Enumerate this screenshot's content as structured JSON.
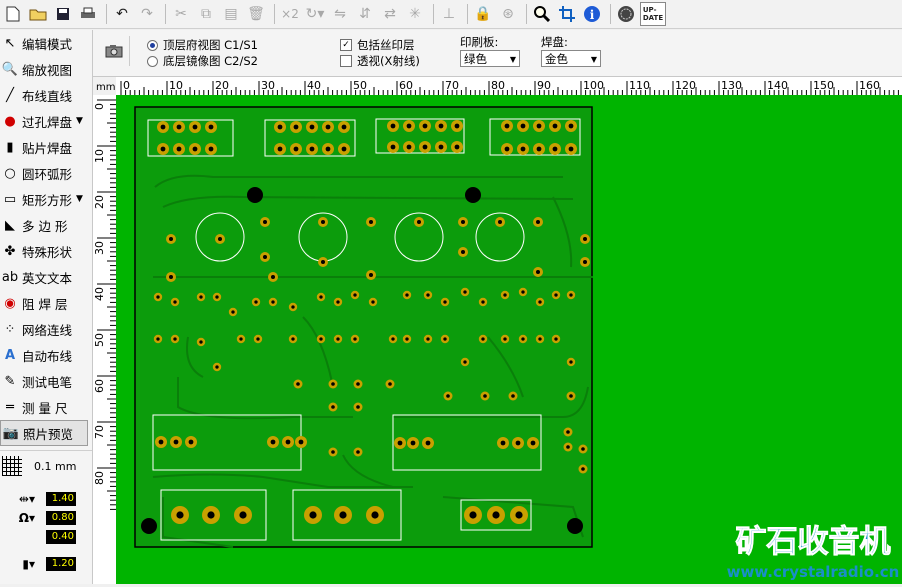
{
  "toolbar": {
    "icons": [
      "new-file-icon",
      "open-folder-icon",
      "save-icon",
      "print-icon",
      "undo-icon",
      "redo-icon",
      "cut-icon",
      "copy-icon",
      "paste-icon",
      "delete-icon",
      "x2-icon",
      "rotate-icon",
      "flip-h-icon",
      "flip-v-icon",
      "mirror-icon",
      "snap-icon",
      "align-icon",
      "lock-icon",
      "unlock-icon",
      "zoom-icon",
      "crop-icon",
      "info-icon",
      "gear-icon",
      "update-icon"
    ],
    "x2_label": "×2",
    "update_label": "UP-\nDATE"
  },
  "sidebar": {
    "items": [
      {
        "label": "编辑模式",
        "icon": "pointer-icon",
        "caret": false
      },
      {
        "label": "缩放视图",
        "icon": "zoom-view-icon",
        "caret": false
      },
      {
        "label": "布线直线",
        "icon": "track-icon",
        "caret": false
      },
      {
        "label": "过孔焊盘",
        "icon": "via-pad-icon",
        "caret": true
      },
      {
        "label": "贴片焊盘",
        "icon": "smd-pad-icon",
        "caret": false
      },
      {
        "label": "圆环弧形",
        "icon": "circle-arc-icon",
        "caret": false
      },
      {
        "label": "矩形方形",
        "icon": "rectangle-icon",
        "caret": true
      },
      {
        "label": "多 边 形",
        "icon": "polygon-icon",
        "caret": false
      },
      {
        "label": "特殊形状",
        "icon": "special-shape-icon",
        "caret": false
      },
      {
        "label": "英文文本",
        "icon": "text-icon",
        "caret": false
      },
      {
        "label": "阻 焊 层",
        "icon": "solder-mask-icon",
        "caret": false
      },
      {
        "label": "网络连线",
        "icon": "netlist-icon",
        "caret": false
      },
      {
        "label": "自动布线",
        "icon": "autoroute-icon",
        "caret": false
      },
      {
        "label": "测试电笔",
        "icon": "test-pen-icon",
        "caret": false
      },
      {
        "label": "测 量 尺",
        "icon": "ruler-icon",
        "caret": false
      },
      {
        "label": "照片预览",
        "icon": "camera-icon",
        "caret": false
      }
    ],
    "grid_label": "0.1 mm",
    "values": [
      "1.40",
      "0.80",
      "0.40",
      "1.20"
    ]
  },
  "topbar": {
    "view_top": "顶层府视图 C1/S1",
    "view_bottom": "底层镜像图 C2/S2",
    "include_silk": "包括丝印层",
    "transparent": "透视(X射线)",
    "board_label": "印刷板:",
    "board_value": "绿色",
    "pad_label": "焊盘:",
    "pad_value": "金色"
  },
  "ruler": {
    "unit": "mm",
    "x_ticks": [
      "0",
      "10",
      "20",
      "30",
      "40",
      "50",
      "60",
      "70",
      "80",
      "90",
      "100",
      "110",
      "120",
      "130",
      "140",
      "150",
      "160"
    ],
    "y_ticks": [
      "0",
      "10",
      "20",
      "30",
      "40",
      "50",
      "60",
      "70",
      "80"
    ]
  },
  "watermark": {
    "title": "矿石收音机",
    "url": "www.crystalradio.cn"
  },
  "colors": {
    "board": "#00b400",
    "copper": "#0a9a0a",
    "trace": "#128a12",
    "pad_gold": "#c8a000",
    "hole": "#000000",
    "silk": "#ffffff",
    "watermark_title": "#1a8fc8"
  }
}
